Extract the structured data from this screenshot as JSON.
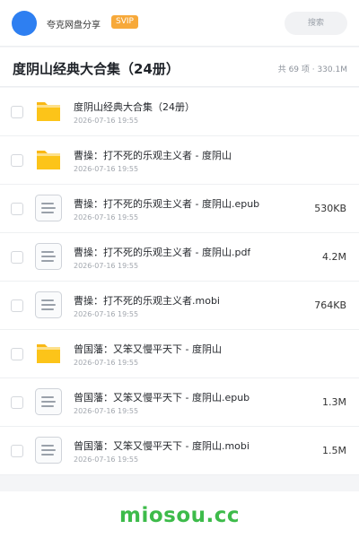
{
  "header": {
    "app_name": "夸克网盘分享",
    "badge": "SVIP",
    "search_placeholder": "搜索"
  },
  "folder": {
    "title": "度阴山经典大合集（24册）",
    "meta": "共 69 项 · 330.1M"
  },
  "files": [
    {
      "type": "folder",
      "name": "度阴山经典大合集（24册）",
      "date": "2026-07-16 19:55",
      "size": ""
    },
    {
      "type": "folder",
      "name": "曹操：打不死的乐观主义者 - 度阴山",
      "date": "2026-07-16 19:55",
      "size": ""
    },
    {
      "type": "doc",
      "name": "曹操：打不死的乐观主义者 - 度阴山.epub",
      "date": "2026-07-16 19:55",
      "size": "530KB"
    },
    {
      "type": "doc",
      "name": "曹操：打不死的乐观主义者 - 度阴山.pdf",
      "date": "2026-07-16 19:55",
      "size": "4.2M"
    },
    {
      "type": "doc",
      "name": "曹操：打不死的乐观主义者.mobi",
      "date": "2026-07-16 19:55",
      "size": "764KB"
    },
    {
      "type": "folder",
      "name": "曾国藩：又笨又慢平天下 - 度阴山",
      "date": "2026-07-16 19:55",
      "size": ""
    },
    {
      "type": "doc",
      "name": "曾国藩：又笨又慢平天下 - 度阴山.epub",
      "date": "2026-07-16 19:55",
      "size": "1.3M"
    },
    {
      "type": "doc",
      "name": "曾国藩：又笨又慢平天下 - 度阴山.mobi",
      "date": "2026-07-16 19:55",
      "size": "1.5M"
    }
  ],
  "watermark": "miosou.cc",
  "colors": {
    "accent": "#2e7ff1",
    "badge": "#f7a93a",
    "folder": "#fcc419",
    "watermark": "#3dbb4a"
  }
}
